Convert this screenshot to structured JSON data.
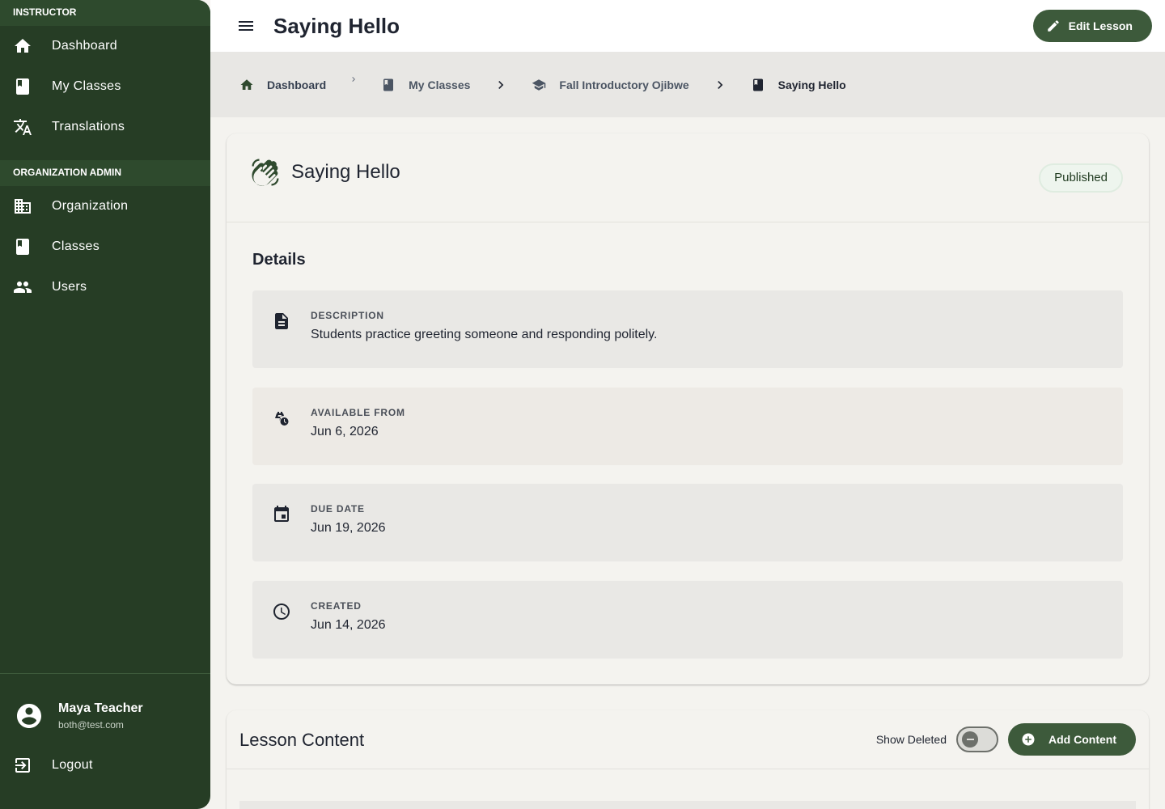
{
  "sidebar": {
    "sections": [
      {
        "header": "INSTRUCTOR",
        "items": [
          {
            "label": "Dashboard",
            "icon": "home-icon"
          },
          {
            "label": "My Classes",
            "icon": "book-icon"
          },
          {
            "label": "Translations",
            "icon": "translate-icon"
          }
        ]
      },
      {
        "header": "ORGANIZATION ADMIN",
        "items": [
          {
            "label": "Organization",
            "icon": "building-icon"
          },
          {
            "label": "Classes",
            "icon": "book-icon"
          },
          {
            "label": "Users",
            "icon": "people-icon"
          }
        ]
      }
    ],
    "user": {
      "name": "Maya Teacher",
      "email": "both@test.com"
    },
    "logout_label": "Logout"
  },
  "topbar": {
    "title": "Saying Hello",
    "edit_label": "Edit Lesson"
  },
  "breadcrumb": [
    {
      "label": "Dashboard",
      "icon": "home-icon"
    },
    {
      "label": "My Classes",
      "icon": "book-icon"
    },
    {
      "label": "Fall Introductory Ojibwe",
      "icon": "school-icon"
    },
    {
      "label": "Saying Hello",
      "icon": "book-icon"
    }
  ],
  "lesson": {
    "title": "Saying Hello",
    "status": "Published",
    "details_title": "Details",
    "details": [
      {
        "label": "DESCRIPTION",
        "value": "Students practice greeting someone and responding politely.",
        "icon": "document-icon"
      },
      {
        "label": "AVAILABLE FROM",
        "value": "Jun 6, 2026",
        "icon": "schedule-bag-icon"
      },
      {
        "label": "DUE DATE",
        "value": "Jun 19, 2026",
        "icon": "calendar-icon"
      },
      {
        "label": "CREATED",
        "value": "Jun 14, 2026",
        "icon": "clock-icon"
      }
    ]
  },
  "content": {
    "title": "Lesson Content",
    "show_deleted_label": "Show Deleted",
    "show_deleted": false,
    "add_label": "Add Content"
  },
  "colors": {
    "sidebar": "#263d25",
    "accent": "#3d5a3b",
    "background": "#f4f3ef"
  }
}
